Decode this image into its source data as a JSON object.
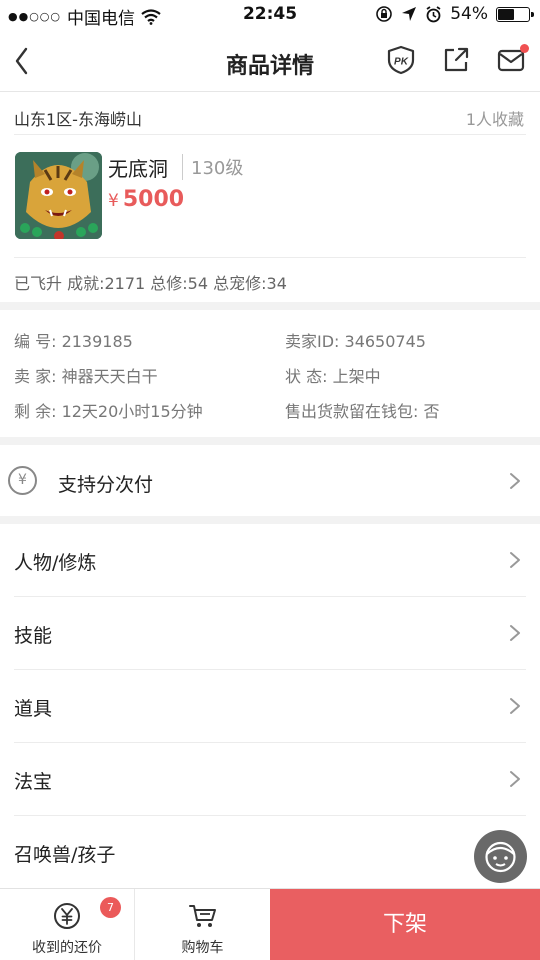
{
  "status_bar": {
    "carrier": "中国电信",
    "time": "22:45",
    "battery": "54%",
    "battery_level": 0.54
  },
  "nav": {
    "title": "商品详情",
    "pk_icon_text": "PK"
  },
  "listing": {
    "server": "山东1区-东海崂山",
    "favorites": "1人收藏",
    "character_name": "无底洞",
    "level": "130级",
    "currency_symbol": "¥",
    "price": "5000",
    "stats": "已飞升 成就:2171 总修:54 总宠修:34"
  },
  "details": {
    "id_label": "编  号: 2139185",
    "seller_id": "卖家ID: 34650745",
    "seller": "卖  家: 神器天天白干",
    "status": "状  态: 上架中",
    "remaining": "剩  余: 12天20小时15分钟",
    "wallet": "售出货款留在钱包: 否"
  },
  "installment": {
    "icon": "yen-circle-icon",
    "label": "支持分次付"
  },
  "menu": [
    {
      "label": "人物/修炼"
    },
    {
      "label": "技能"
    },
    {
      "label": "道具"
    },
    {
      "label": "法宝"
    },
    {
      "label": "召唤兽/孩子"
    }
  ],
  "bottom_bar": {
    "offers_label": "收到的还价",
    "offers_badge": "7",
    "cart_label": "购物车",
    "delist_label": "下架"
  },
  "colors": {
    "accent": "#e95f61",
    "price": "#e85b5b",
    "badge": "#eb5a5a"
  }
}
